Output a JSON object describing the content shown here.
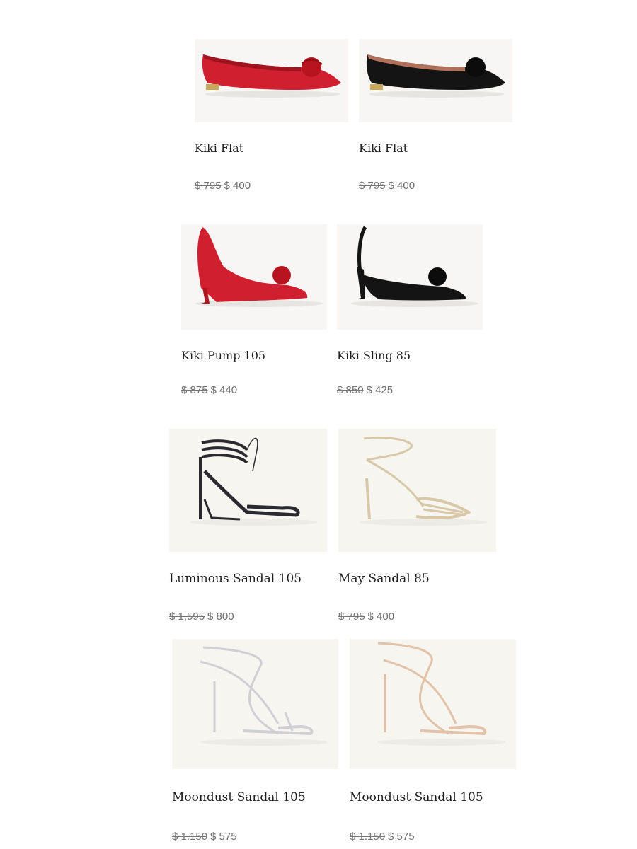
{
  "products": [
    {
      "name": "Kiki Flat",
      "old_price": "$ 795",
      "price": "$ 400",
      "image": "red-bow-flat",
      "color": "#d0202f"
    },
    {
      "name": "Kiki Flat",
      "old_price": "$ 795",
      "price": "$ 400",
      "image": "black-bow-flat",
      "color": "#141414"
    },
    {
      "name": "Kiki Pump 105",
      "old_price": "$ 875",
      "price": "$ 440",
      "image": "red-bow-pump",
      "color": "#d0202f"
    },
    {
      "name": "Kiki Sling 85",
      "old_price": "$ 850",
      "price": "$ 425",
      "image": "black-bow-slingback",
      "color": "#141414"
    },
    {
      "name": "Luminous Sandal 105",
      "old_price": "$ 1,595",
      "price": "$ 800",
      "image": "black-crystal-lace-up-sandal",
      "color": "#2a2a30"
    },
    {
      "name": "May Sandal 85",
      "old_price": "$ 795",
      "price": "$ 400",
      "image": "gold-strappy-sandal",
      "color": "#d8c8a8"
    },
    {
      "name": "Moondust Sandal 105",
      "old_price": "$ 1.150",
      "price": "$ 575",
      "image": "silver-strappy-sandal",
      "color": "#cfcfd4"
    },
    {
      "name": "Moondust Sandal 105",
      "old_price": "$ 1.150",
      "price": "$ 575",
      "image": "nude-strappy-sandal",
      "color": "#e2c2a8"
    }
  ]
}
